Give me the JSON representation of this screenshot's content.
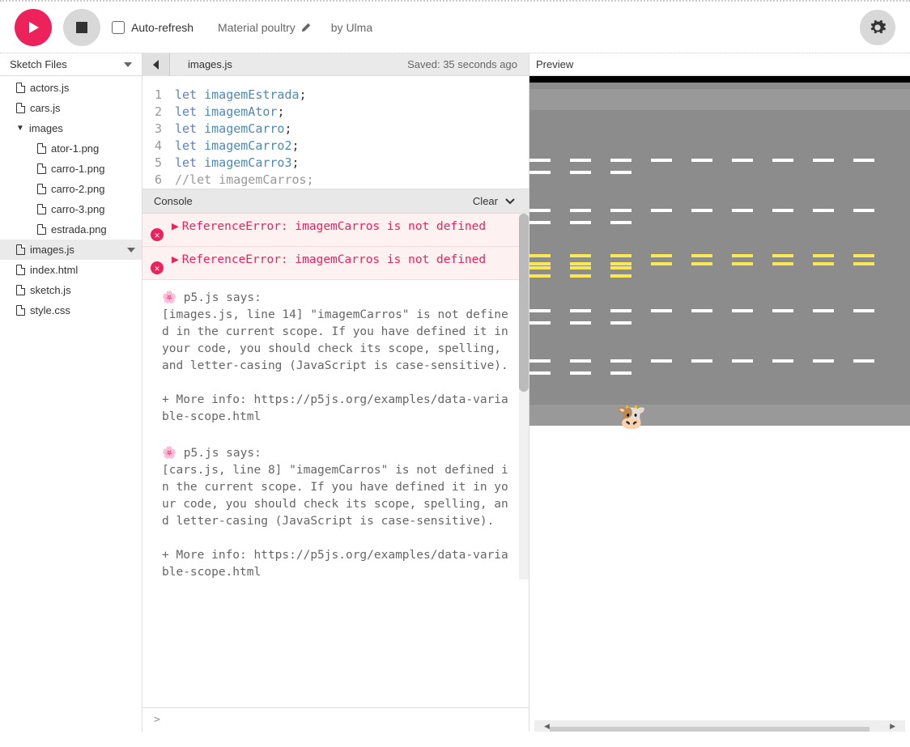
{
  "toolbar": {
    "auto_refresh_label": "Auto-refresh",
    "project_name": "Material poultry",
    "by_prefix": "by ",
    "author": "Ulma"
  },
  "sidebar": {
    "title": "Sketch Files",
    "files": [
      {
        "name": "actors.js",
        "type": "file"
      },
      {
        "name": "cars.js",
        "type": "file"
      },
      {
        "name": "images",
        "type": "folder"
      },
      {
        "name": "ator-1.png",
        "type": "file",
        "nested": true
      },
      {
        "name": "carro-1.png",
        "type": "file",
        "nested": true
      },
      {
        "name": "carro-2.png",
        "type": "file",
        "nested": true
      },
      {
        "name": "carro-3.png",
        "type": "file",
        "nested": true
      },
      {
        "name": "estrada.png",
        "type": "file",
        "nested": true
      },
      {
        "name": "images.js",
        "type": "file",
        "selected": true
      },
      {
        "name": "index.html",
        "type": "file"
      },
      {
        "name": "sketch.js",
        "type": "file"
      },
      {
        "name": "style.css",
        "type": "file"
      }
    ]
  },
  "editor": {
    "filename": "images.js",
    "saved_label": "Saved: 35 seconds ago",
    "lines": [
      {
        "n": 1,
        "tokens": [
          {
            "t": "let ",
            "c": "kw"
          },
          {
            "t": "imagemEstrada",
            "c": "var"
          },
          {
            "t": ";",
            "c": ""
          }
        ]
      },
      {
        "n": 2,
        "tokens": [
          {
            "t": "let ",
            "c": "kw"
          },
          {
            "t": "imagemAtor",
            "c": "var"
          },
          {
            "t": ";",
            "c": ""
          }
        ]
      },
      {
        "n": 3,
        "tokens": [
          {
            "t": "let ",
            "c": "kw"
          },
          {
            "t": "imagemCarro",
            "c": "var"
          },
          {
            "t": ";",
            "c": ""
          }
        ]
      },
      {
        "n": 4,
        "tokens": [
          {
            "t": "let ",
            "c": "kw"
          },
          {
            "t": "imagemCarro2",
            "c": "var"
          },
          {
            "t": ";",
            "c": ""
          }
        ]
      },
      {
        "n": 5,
        "tokens": [
          {
            "t": "let ",
            "c": "kw"
          },
          {
            "t": "imagemCarro3",
            "c": "var"
          },
          {
            "t": ";",
            "c": ""
          }
        ]
      },
      {
        "n": 6,
        "tokens": [
          {
            "t": "//let imagemCarros;",
            "c": "cmt"
          }
        ]
      }
    ]
  },
  "console": {
    "title": "Console",
    "clear_label": "Clear",
    "errors": [
      "ReferenceError: imagemCarros is not defined",
      "ReferenceError: imagemCarros is not defined"
    ],
    "messages": [
      "🌸 p5.js says:\n[images.js, line 14] \"imagemCarros\" is not defined in the current scope. If you have defined it in your code, you should check its scope, spelling, and letter-casing (JavaScript is case-sensitive).\n\n+ More info: https://p5js.org/examples/data-variable-scope.html",
      "🌸 p5.js says:\n[cars.js, line 8] \"imagemCarros\" is not defined in the current scope. If you have defined it in your code, you should check its scope, spelling, and letter-casing (JavaScript is case-sensitive).\n\n+ More info: https://p5js.org/examples/data-variable-scope.html"
    ],
    "prompt": ">"
  },
  "preview": {
    "title": "Preview"
  }
}
